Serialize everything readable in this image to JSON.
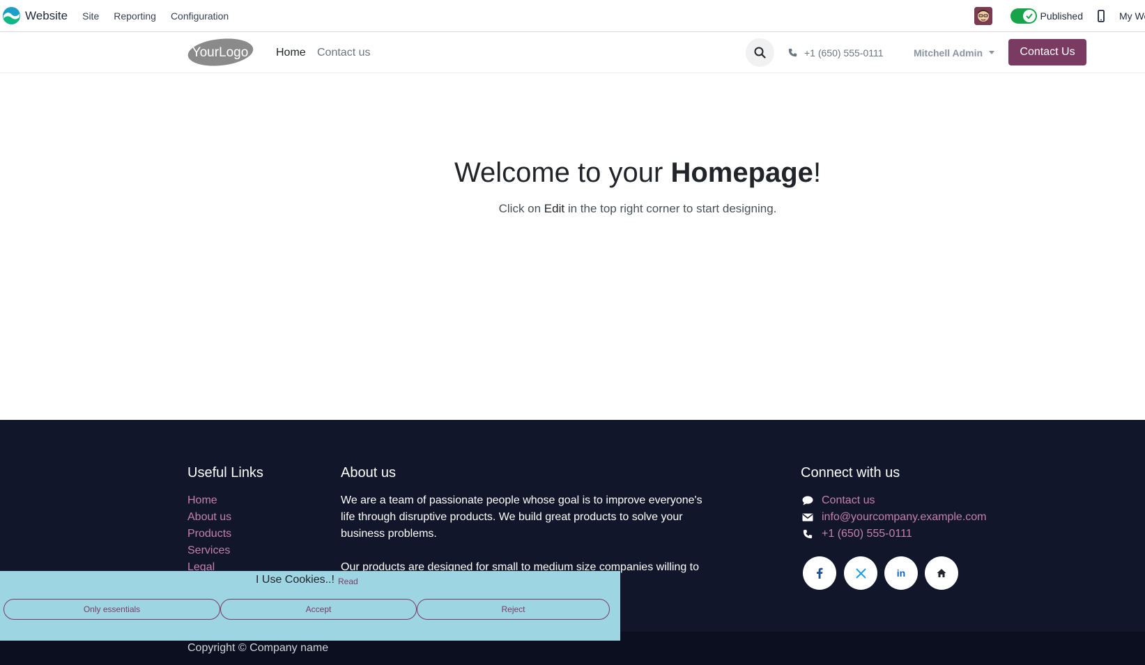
{
  "topbar": {
    "app_name": "Website",
    "menus": [
      "Site",
      "Reporting",
      "Configuration"
    ],
    "published_label": "Published",
    "website_label": "My Website"
  },
  "header": {
    "logo_text": "YourLogo",
    "nav": [
      "Home",
      "Contact us"
    ],
    "phone": "+1 (650) 555-0111",
    "user": "Mitchell Admin",
    "cta": "Contact Us"
  },
  "hero": {
    "title_pre": "Welcome to your ",
    "title_bold": "Homepage",
    "title_post": "!",
    "sub_pre": "Click on ",
    "sub_em": "Edit",
    "sub_post": " in the top right corner to start designing."
  },
  "footer": {
    "useful_links_title": "Useful Links",
    "useful_links": [
      "Home",
      "About us",
      "Products",
      "Services",
      "Legal"
    ],
    "about_title": "About us",
    "about_lines": [
      "We are a team of passionate people whose goal is to improve everyone's",
      "life through disruptive products. We build great products to solve your",
      "business problems.",
      "Our products are designed for small to medium size companies willing to"
    ],
    "connect_title": "Connect with us",
    "connect_items": [
      "Contact us",
      "info@yourcompany.example.com",
      "+1 (650) 555-0111"
    ],
    "social": [
      "facebook",
      "x",
      "linkedin",
      "home"
    ],
    "copyright": "Copyright © Company name"
  },
  "cookie": {
    "title": "I Use Cookies..!",
    "read_link": "Read",
    "buttons": [
      "Only essentials",
      "Accept",
      "Reject"
    ]
  },
  "colors": {
    "brand": "#7a3b63",
    "footer_bg": "#11162b",
    "link": "#c580b0",
    "cookie_bg": "#9ed5e3",
    "published": "#16a34a"
  }
}
